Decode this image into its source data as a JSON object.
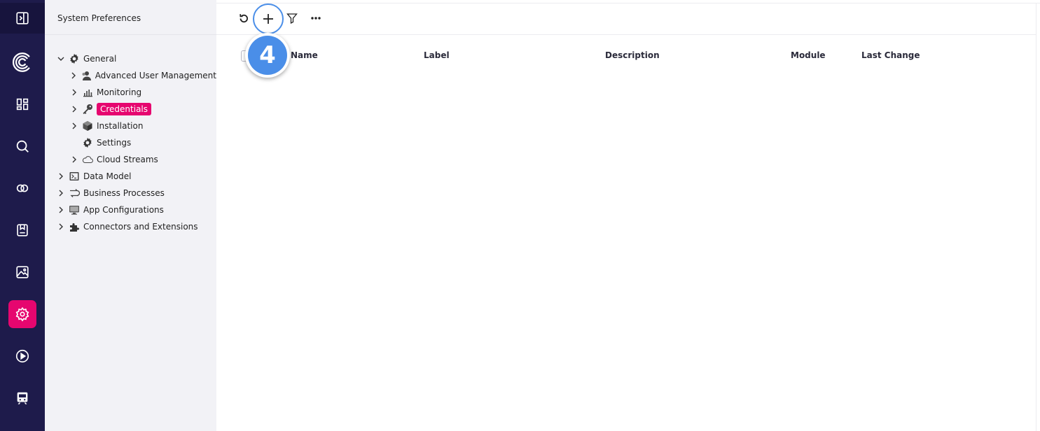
{
  "rail": {
    "items": [
      {
        "icon": "sidebar-toggle-icon"
      },
      {
        "icon": "logo-icon"
      },
      {
        "icon": "dashboard-icon"
      },
      {
        "icon": "search-icon"
      },
      {
        "icon": "link-icon"
      },
      {
        "icon": "bookmark-icon"
      },
      {
        "icon": "image-icon"
      },
      {
        "icon": "settings-icon",
        "active": true
      },
      {
        "icon": "play-icon"
      },
      {
        "icon": "train-icon"
      }
    ],
    "active_color": "#e6066f",
    "background": "#1e1b4b"
  },
  "tree": {
    "header": "System Preferences",
    "items": [
      {
        "label": "General",
        "icon": "gear-icon",
        "level": 0,
        "expanded": true
      },
      {
        "label": "Advanced User Management",
        "icon": "users-icon",
        "level": 1
      },
      {
        "label": "Monitoring",
        "icon": "bar-chart-icon",
        "level": 1
      },
      {
        "label": "Credentials",
        "icon": "key-icon",
        "level": 1,
        "selected": true
      },
      {
        "label": "Installation",
        "icon": "cube-icon",
        "level": 1
      },
      {
        "label": "Settings",
        "icon": "gear-icon",
        "level": 1,
        "leaf": true
      },
      {
        "label": "Cloud Streams",
        "icon": "cloud-icon",
        "level": 1
      },
      {
        "label": "Data Model",
        "icon": "terminal-icon",
        "level": 0
      },
      {
        "label": "Business Processes",
        "icon": "process-icon",
        "level": 0
      },
      {
        "label": "App Configurations",
        "icon": "monitor-icon",
        "level": 0
      },
      {
        "label": "Connectors and Extensions",
        "icon": "puzzle-icon",
        "level": 0
      }
    ]
  },
  "toolbar": {
    "buttons": [
      "refresh-icon",
      "add-icon",
      "filter-icon",
      "more-icon"
    ]
  },
  "table": {
    "columns": [
      "Name",
      "Label",
      "Description",
      "Module",
      "Last Change"
    ]
  },
  "step_badge": "4"
}
